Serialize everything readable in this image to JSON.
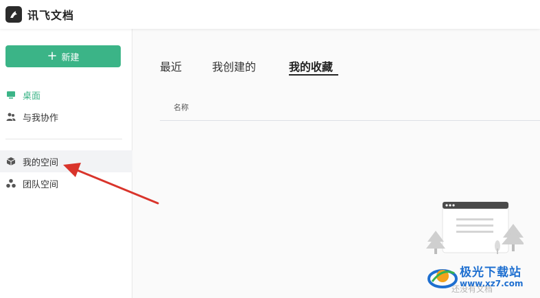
{
  "app": {
    "title": "讯飞文档"
  },
  "sidebar": {
    "new_button": "新建",
    "items": [
      {
        "label": "桌面",
        "icon": "monitor-icon"
      },
      {
        "label": "与我协作",
        "icon": "users-icon"
      },
      {
        "label": "我的空间",
        "icon": "cube-icon"
      },
      {
        "label": "团队空间",
        "icon": "team-icon"
      }
    ]
  },
  "main": {
    "tabs": [
      {
        "label": "最近"
      },
      {
        "label": "我创建的"
      },
      {
        "label": "我的收藏"
      }
    ],
    "active_tab": "我的收藏",
    "column_header": "名称",
    "empty_text": "还没有文档"
  },
  "watermark": {
    "brand": "极光下载站",
    "url": "www.xz7.com"
  },
  "colors": {
    "accent": "#3bb487",
    "arrow": "#d9342b"
  }
}
